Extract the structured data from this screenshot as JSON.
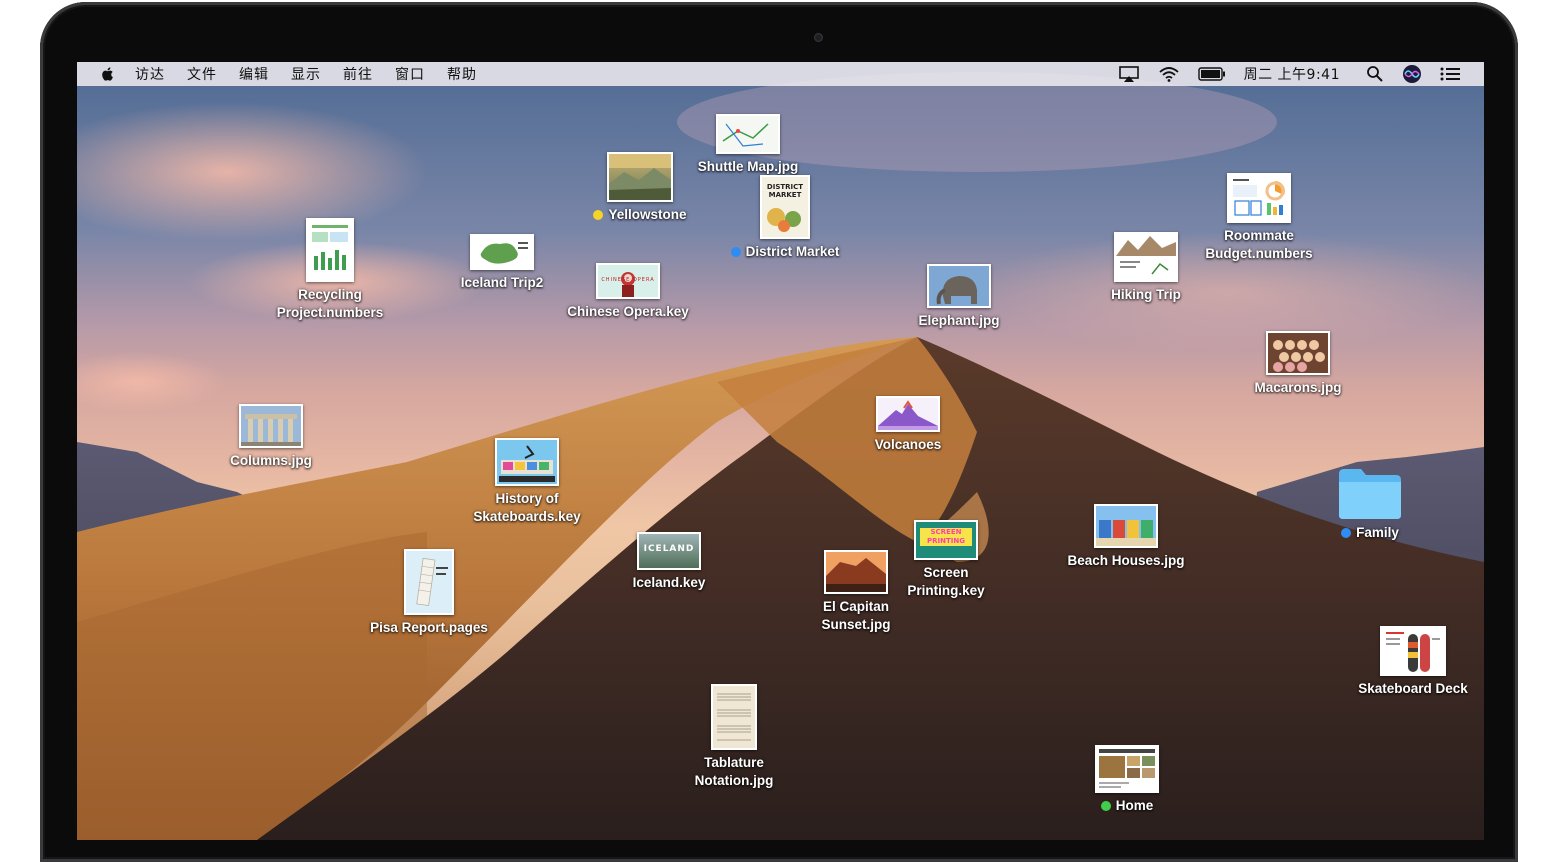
{
  "menubar": {
    "items": [
      "访达",
      "文件",
      "编辑",
      "显示",
      "前往",
      "窗口",
      "帮助"
    ],
    "clock": "周二 上午9:41"
  },
  "icons": {
    "apple": "apple-logo-icon",
    "airplay": "airplay-icon",
    "wifi": "wifi-icon",
    "battery": "battery-icon",
    "search": "spotlight-search-icon",
    "siri": "siri-icon",
    "notifications": "notification-center-icon",
    "folder": "folder-icon"
  },
  "colors": {
    "tag_yellow": "#f5d327",
    "tag_blue": "#2f8cf3",
    "tag_green": "#3fcf4a",
    "folder": "#6cc4f6"
  },
  "files": {
    "shuttle_map": {
      "label": "Shuttle Map.jpg"
    },
    "yellowstone": {
      "label": "Yellowstone",
      "tag": "yellow"
    },
    "district_market": {
      "label": "District Market",
      "tag": "blue"
    },
    "recycling": {
      "label": "Recycling\nProject.numbers"
    },
    "iceland_trip2": {
      "label": "Iceland Trip2"
    },
    "chinese_opera": {
      "label": "Chinese Opera.key"
    },
    "elephant": {
      "label": "Elephant.jpg"
    },
    "hiking_trip": {
      "label": "Hiking Trip"
    },
    "roommate_budget": {
      "label": "Roommate\nBudget.numbers"
    },
    "macarons": {
      "label": "Macarons.jpg"
    },
    "columns": {
      "label": "Columns.jpg"
    },
    "volcanoes": {
      "label": "Volcanoes"
    },
    "skateboards": {
      "label": "History of\nSkateboards.key"
    },
    "family": {
      "label": "Family",
      "tag": "blue"
    },
    "beach_houses": {
      "label": "Beach Houses.jpg"
    },
    "screen_printing": {
      "label": "Screen\nPrinting.key"
    },
    "iceland_key": {
      "label": "Iceland.key"
    },
    "el_capitan": {
      "label": "El Capitan\nSunset.jpg"
    },
    "pisa": {
      "label": "Pisa Report.pages"
    },
    "skateboard_deck": {
      "label": "Skateboard Deck"
    },
    "tablature": {
      "label": "Tablature\nNotation.jpg"
    },
    "home": {
      "label": "Home",
      "tag": "green"
    }
  },
  "thumb_text": {
    "district_market": "DISTRICT MARKET",
    "chinese_opera": "CHINESE OPERA",
    "iceland": "ICELAND",
    "screen_printing": "SCREEN PRINTING"
  }
}
